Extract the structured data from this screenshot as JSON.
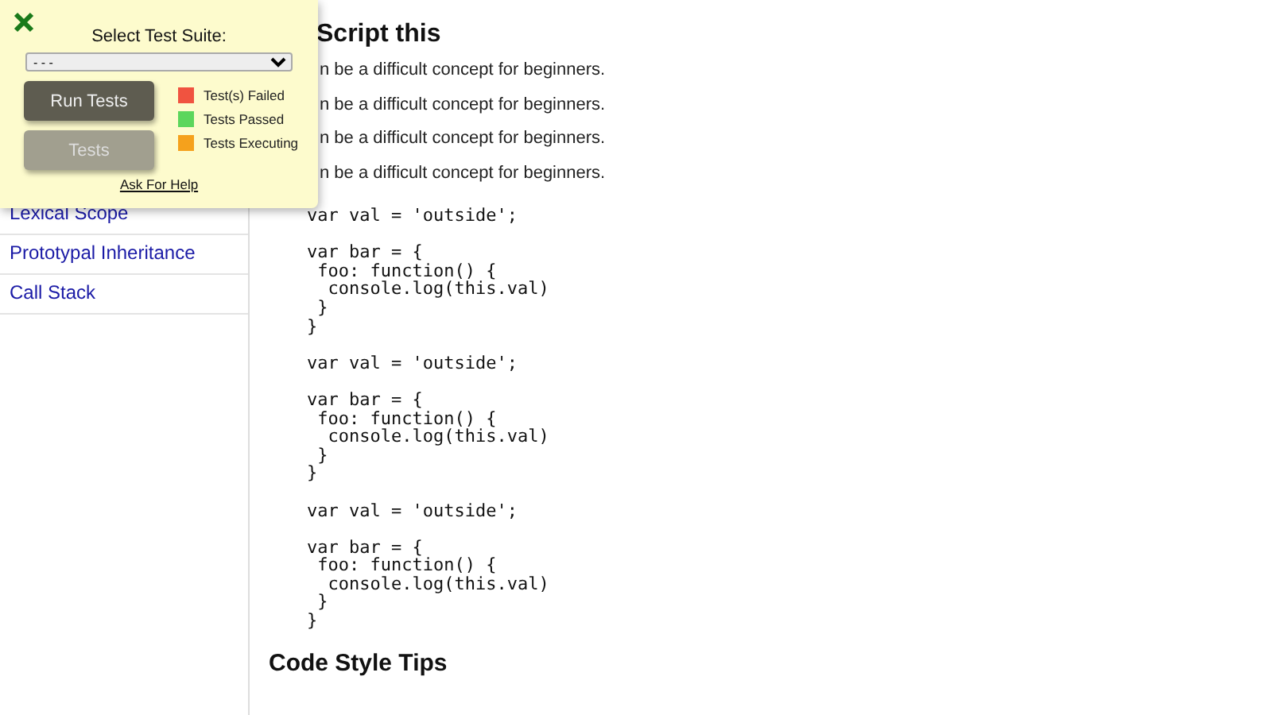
{
  "sidebar": {
    "items": [
      {
        "label": "Lexical Scope"
      },
      {
        "label": "Prototypal Inheritance"
      },
      {
        "label": "Call Stack"
      }
    ]
  },
  "main": {
    "heading": "Script this",
    "paragraphs": [
      "n be a difficult concept for beginners.",
      "n be a difficult concept for beginners.",
      "n be a difficult concept for beginners.",
      "n be a difficult concept for beginners."
    ],
    "code_groups": [
      [
        "var val = 'outside';"
      ],
      [
        "var bar = {",
        " foo: function() {",
        "  console.log(this.val)",
        " }",
        "}"
      ],
      [
        "var val = 'outside';"
      ],
      [
        "var bar = {",
        " foo: function() {",
        "  console.log(this.val)",
        " }",
        "}"
      ],
      [
        "var val = 'outside';"
      ],
      [
        "var bar = {",
        " foo: function() {",
        "  console.log(this.val)",
        " }",
        "}"
      ]
    ],
    "subheading": "Code Style Tips"
  },
  "test_panel": {
    "label": "Select Test Suite:",
    "select_value": "- - -",
    "buttons": [
      {
        "label": "Run Tests",
        "disabled": false
      },
      {
        "label": "Tests",
        "disabled": true
      }
    ],
    "legend": [
      {
        "label": "Test(s) Failed",
        "color": "#f05340"
      },
      {
        "label": "Tests Passed",
        "color": "#5cd65c"
      },
      {
        "label": "Tests Executing",
        "color": "#f5a11c"
      }
    ],
    "help_link": "Ask For Help"
  }
}
